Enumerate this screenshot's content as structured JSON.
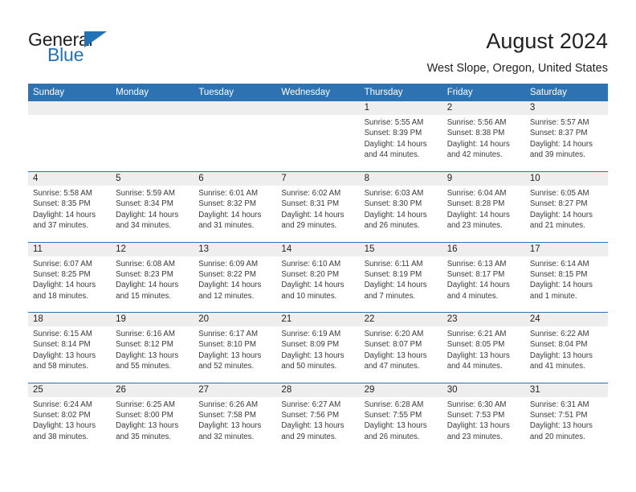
{
  "brand": {
    "word_general": "General",
    "word_blue": "Blue",
    "triangle_color": "#2272b8"
  },
  "header": {
    "title": "August 2024",
    "subtitle": "West Slope, Oregon, United States",
    "accent_color": "#2E72B2",
    "daynum_band_color": "#eeeeee"
  },
  "weekday_headers": [
    "Sunday",
    "Monday",
    "Tuesday",
    "Wednesday",
    "Thursday",
    "Friday",
    "Saturday"
  ],
  "labels": {
    "sunrise_prefix": "Sunrise:",
    "sunset_prefix": "Sunset:",
    "daylight_prefix": "Daylight:"
  },
  "calendar": {
    "month": "August",
    "year": "2024",
    "weeks": [
      [
        {
          "day": "",
          "empty": true
        },
        {
          "day": "",
          "empty": true
        },
        {
          "day": "",
          "empty": true
        },
        {
          "day": "",
          "empty": true
        },
        {
          "day": "1",
          "sunrise": "Sunrise: 5:55 AM",
          "sunset": "Sunset: 8:39 PM",
          "daylight": "Daylight: 14 hours and 44 minutes."
        },
        {
          "day": "2",
          "sunrise": "Sunrise: 5:56 AM",
          "sunset": "Sunset: 8:38 PM",
          "daylight": "Daylight: 14 hours and 42 minutes."
        },
        {
          "day": "3",
          "sunrise": "Sunrise: 5:57 AM",
          "sunset": "Sunset: 8:37 PM",
          "daylight": "Daylight: 14 hours and 39 minutes."
        }
      ],
      [
        {
          "day": "4",
          "sunrise": "Sunrise: 5:58 AM",
          "sunset": "Sunset: 8:35 PM",
          "daylight": "Daylight: 14 hours and 37 minutes."
        },
        {
          "day": "5",
          "sunrise": "Sunrise: 5:59 AM",
          "sunset": "Sunset: 8:34 PM",
          "daylight": "Daylight: 14 hours and 34 minutes."
        },
        {
          "day": "6",
          "sunrise": "Sunrise: 6:01 AM",
          "sunset": "Sunset: 8:32 PM",
          "daylight": "Daylight: 14 hours and 31 minutes."
        },
        {
          "day": "7",
          "sunrise": "Sunrise: 6:02 AM",
          "sunset": "Sunset: 8:31 PM",
          "daylight": "Daylight: 14 hours and 29 minutes."
        },
        {
          "day": "8",
          "sunrise": "Sunrise: 6:03 AM",
          "sunset": "Sunset: 8:30 PM",
          "daylight": "Daylight: 14 hours and 26 minutes."
        },
        {
          "day": "9",
          "sunrise": "Sunrise: 6:04 AM",
          "sunset": "Sunset: 8:28 PM",
          "daylight": "Daylight: 14 hours and 23 minutes."
        },
        {
          "day": "10",
          "sunrise": "Sunrise: 6:05 AM",
          "sunset": "Sunset: 8:27 PM",
          "daylight": "Daylight: 14 hours and 21 minutes."
        }
      ],
      [
        {
          "day": "11",
          "sunrise": "Sunrise: 6:07 AM",
          "sunset": "Sunset: 8:25 PM",
          "daylight": "Daylight: 14 hours and 18 minutes."
        },
        {
          "day": "12",
          "sunrise": "Sunrise: 6:08 AM",
          "sunset": "Sunset: 8:23 PM",
          "daylight": "Daylight: 14 hours and 15 minutes."
        },
        {
          "day": "13",
          "sunrise": "Sunrise: 6:09 AM",
          "sunset": "Sunset: 8:22 PM",
          "daylight": "Daylight: 14 hours and 12 minutes."
        },
        {
          "day": "14",
          "sunrise": "Sunrise: 6:10 AM",
          "sunset": "Sunset: 8:20 PM",
          "daylight": "Daylight: 14 hours and 10 minutes."
        },
        {
          "day": "15",
          "sunrise": "Sunrise: 6:11 AM",
          "sunset": "Sunset: 8:19 PM",
          "daylight": "Daylight: 14 hours and 7 minutes."
        },
        {
          "day": "16",
          "sunrise": "Sunrise: 6:13 AM",
          "sunset": "Sunset: 8:17 PM",
          "daylight": "Daylight: 14 hours and 4 minutes."
        },
        {
          "day": "17",
          "sunrise": "Sunrise: 6:14 AM",
          "sunset": "Sunset: 8:15 PM",
          "daylight": "Daylight: 14 hours and 1 minute."
        }
      ],
      [
        {
          "day": "18",
          "sunrise": "Sunrise: 6:15 AM",
          "sunset": "Sunset: 8:14 PM",
          "daylight": "Daylight: 13 hours and 58 minutes."
        },
        {
          "day": "19",
          "sunrise": "Sunrise: 6:16 AM",
          "sunset": "Sunset: 8:12 PM",
          "daylight": "Daylight: 13 hours and 55 minutes."
        },
        {
          "day": "20",
          "sunrise": "Sunrise: 6:17 AM",
          "sunset": "Sunset: 8:10 PM",
          "daylight": "Daylight: 13 hours and 52 minutes."
        },
        {
          "day": "21",
          "sunrise": "Sunrise: 6:19 AM",
          "sunset": "Sunset: 8:09 PM",
          "daylight": "Daylight: 13 hours and 50 minutes."
        },
        {
          "day": "22",
          "sunrise": "Sunrise: 6:20 AM",
          "sunset": "Sunset: 8:07 PM",
          "daylight": "Daylight: 13 hours and 47 minutes."
        },
        {
          "day": "23",
          "sunrise": "Sunrise: 6:21 AM",
          "sunset": "Sunset: 8:05 PM",
          "daylight": "Daylight: 13 hours and 44 minutes."
        },
        {
          "day": "24",
          "sunrise": "Sunrise: 6:22 AM",
          "sunset": "Sunset: 8:04 PM",
          "daylight": "Daylight: 13 hours and 41 minutes."
        }
      ],
      [
        {
          "day": "25",
          "sunrise": "Sunrise: 6:24 AM",
          "sunset": "Sunset: 8:02 PM",
          "daylight": "Daylight: 13 hours and 38 minutes."
        },
        {
          "day": "26",
          "sunrise": "Sunrise: 6:25 AM",
          "sunset": "Sunset: 8:00 PM",
          "daylight": "Daylight: 13 hours and 35 minutes."
        },
        {
          "day": "27",
          "sunrise": "Sunrise: 6:26 AM",
          "sunset": "Sunset: 7:58 PM",
          "daylight": "Daylight: 13 hours and 32 minutes."
        },
        {
          "day": "28",
          "sunrise": "Sunrise: 6:27 AM",
          "sunset": "Sunset: 7:56 PM",
          "daylight": "Daylight: 13 hours and 29 minutes."
        },
        {
          "day": "29",
          "sunrise": "Sunrise: 6:28 AM",
          "sunset": "Sunset: 7:55 PM",
          "daylight": "Daylight: 13 hours and 26 minutes."
        },
        {
          "day": "30",
          "sunrise": "Sunrise: 6:30 AM",
          "sunset": "Sunset: 7:53 PM",
          "daylight": "Daylight: 13 hours and 23 minutes."
        },
        {
          "day": "31",
          "sunrise": "Sunrise: 6:31 AM",
          "sunset": "Sunset: 7:51 PM",
          "daylight": "Daylight: 13 hours and 20 minutes."
        }
      ]
    ]
  }
}
